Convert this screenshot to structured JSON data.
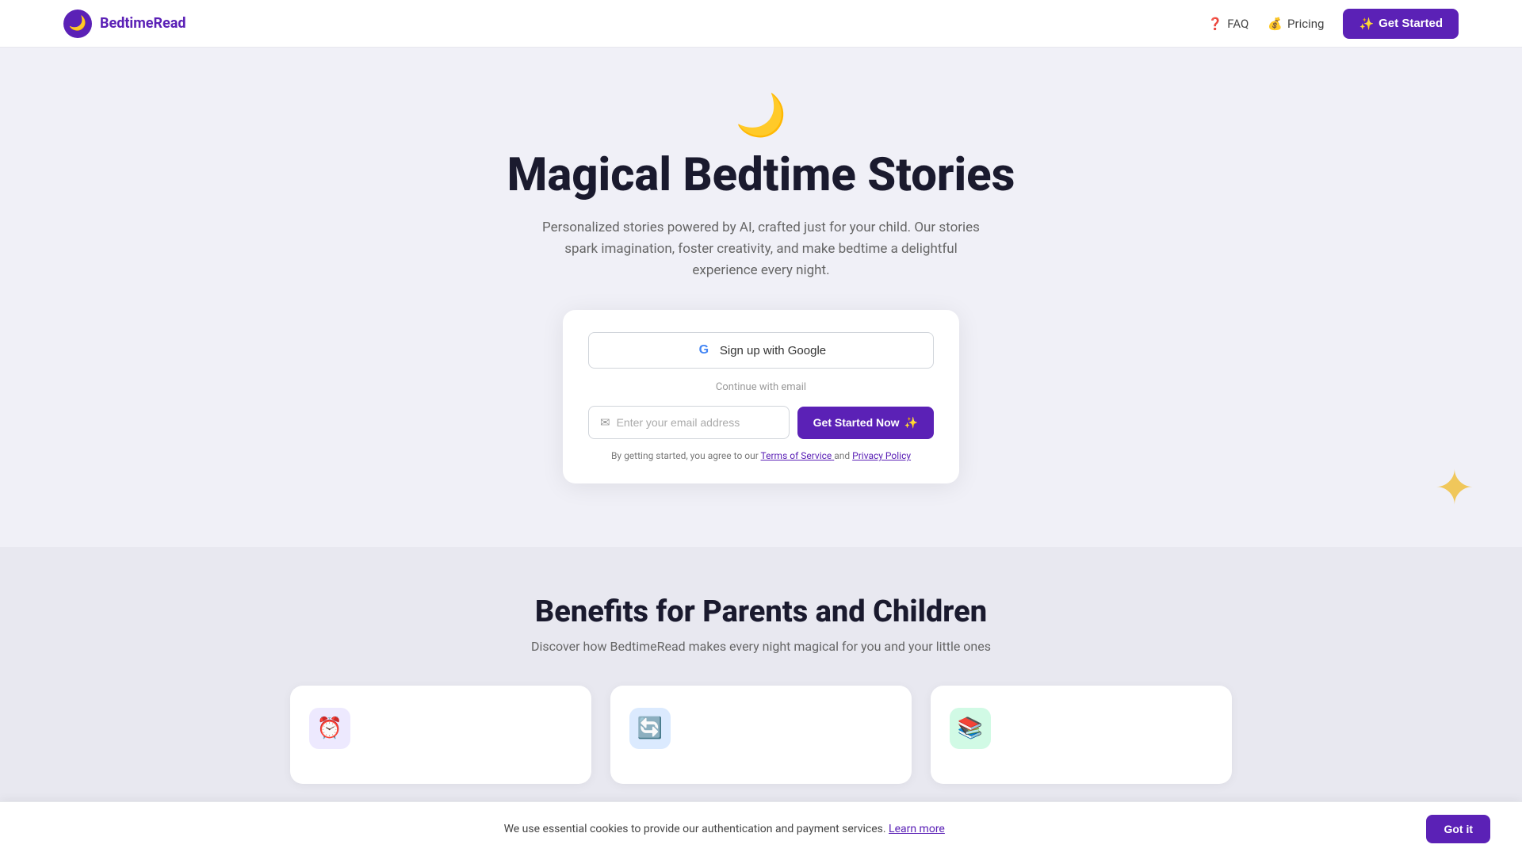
{
  "nav": {
    "logo_text": "BedtimeRead",
    "faq_label": "FAQ",
    "pricing_label": "Pricing",
    "get_started_label": "Get Started"
  },
  "hero": {
    "moon_char": "🌙",
    "title": "Magical Bedtime Stories",
    "subtitle": "Personalized stories powered by AI, crafted just for your child. Our stories spark imagination, foster creativity, and make bedtime a delightful experience every night."
  },
  "signup": {
    "google_button_label": "Sign up with Google",
    "divider_label": "Continue with email",
    "email_placeholder": "Enter your email address",
    "cta_label": "Get Started Now",
    "terms_prefix": "By getting started, you agree to our",
    "terms_link_label": "Terms of Service",
    "and_text": "and",
    "privacy_link_label": "Privacy Policy"
  },
  "benefits": {
    "title": "Benefits for Parents and Children",
    "subtitle": "Discover how BedtimeRead makes every night magical for you and your little ones",
    "cards": [
      {
        "id": "card-1",
        "emoji": "⏰",
        "color": "purple"
      },
      {
        "id": "card-2",
        "emoji": "🔄",
        "color": "blue"
      },
      {
        "id": "card-3",
        "emoji": "📚",
        "color": "green"
      }
    ]
  },
  "deco": {
    "star_char": "✦"
  },
  "cookie": {
    "text": "We use essential cookies to provide our authentication and payment services.",
    "learn_more_label": "Learn more",
    "got_it_label": "Got it"
  }
}
